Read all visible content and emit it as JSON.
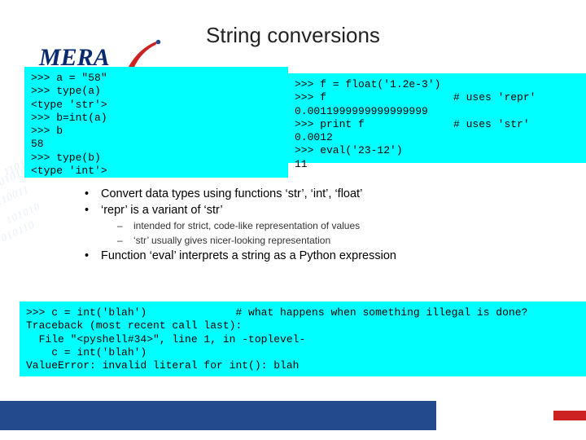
{
  "title": "String conversions",
  "logo": "MERA",
  "bgnums": [
    "110101001",
    "001010",
    "110011",
    "101010",
    "010110"
  ],
  "code1": ">>> a = \"58\"\n>>> type(a)\n<type 'str'>\n>>> b=int(a)\n>>> b\n58\n>>> type(b)\n<type 'int'>",
  "code2": ">>> f = float('1.2e-3')\n>>> f                    # uses 'repr'\n0.0011999999999999999\n>>> print f              # uses 'str'\n0.0012\n>>> eval('23-12')\n11",
  "code3": ">>> c = int('blah')              # what happens when something illegal is done?\nTraceback (most recent call last):\n  File \"<pyshell#34>\", line 1, in -toplevel-\n    c = int('blah')\nValueError: invalid literal for int(): blah",
  "bullets": {
    "b1": "Convert data types using functions ‘str’, ‘int’, ‘float’",
    "b2": "‘repr’ is a variant of ‘str’",
    "b2a": "intended for strict, code-like representation of values",
    "b2b": "‘str’ usually gives nicer-looking representation",
    "b3": "Function ‘eval’ interprets a string as a Python expression"
  }
}
